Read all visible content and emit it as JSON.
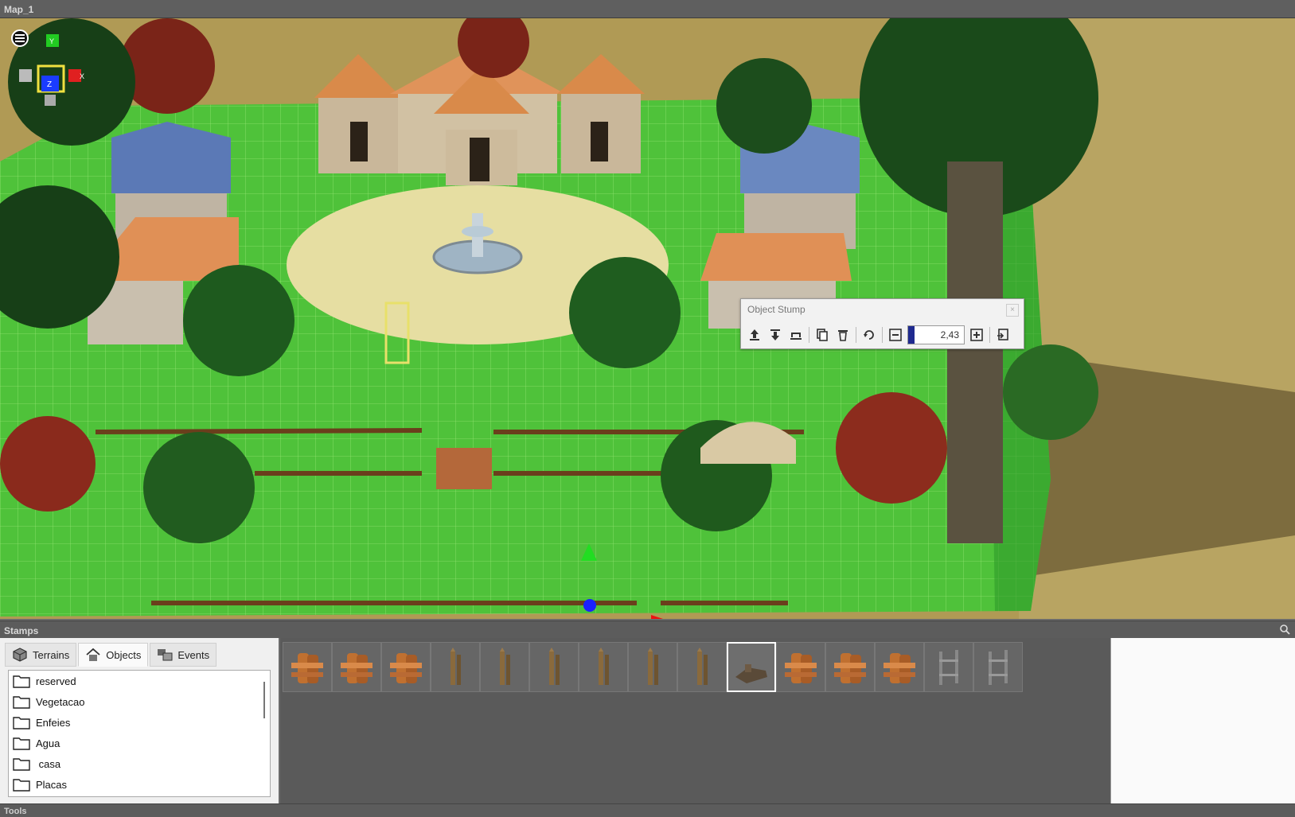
{
  "window": {
    "title": "Map_1"
  },
  "viewport": {
    "gizmo_axes": {
      "y": "Y",
      "z": "Z",
      "x": "X"
    },
    "colors": {
      "x_axis": "#e02020",
      "y_axis": "#22cc22",
      "z_axis": "#1a3cff",
      "selection": "#f0e040"
    }
  },
  "object_panel": {
    "title": "Object Stump",
    "close": "×",
    "scale_value": "2,43",
    "scale_fill_fraction": 0.12,
    "tools": [
      "raise-icon",
      "lower-icon",
      "ground-icon",
      "copy-icon",
      "delete-icon",
      "rotate-icon",
      "minus-icon",
      "plus-icon",
      "export-icon"
    ]
  },
  "stamps": {
    "title": "Stamps",
    "tabs": [
      {
        "label": "Terrains",
        "icon": "cube-icon"
      },
      {
        "label": "Objects",
        "icon": "house-icon",
        "active": true
      },
      {
        "label": "Events",
        "icon": "events-icon"
      }
    ],
    "folders": [
      "reserved",
      "Vegetacao",
      "Enfeies",
      "Agua",
      " casa",
      "Placas"
    ],
    "palette": [
      "fence-post-double",
      "fence-post-double-2",
      "fence-post-short",
      "fence-stake-pair",
      "fence-stake-triple",
      "fence-stake-thin",
      "fence-stake-thin-2",
      "fence-stake-single",
      "fence-stake-single-2",
      "broken-stump",
      "fence-post-double-3",
      "fence-post-short-2",
      "fence-post-double-4",
      "iron-fence",
      "iron-fence-2"
    ],
    "selected_index": 9
  },
  "tools": {
    "title": "Tools"
  }
}
